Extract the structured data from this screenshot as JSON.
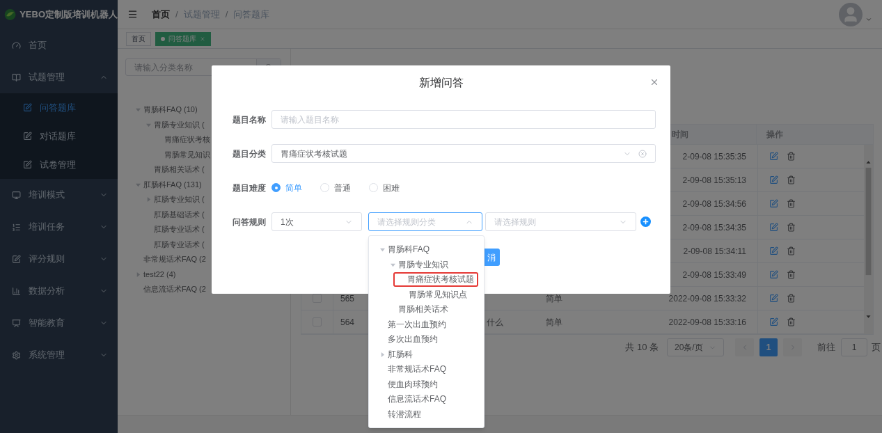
{
  "sidebar": {
    "title": "YEBO定制版培训机器人",
    "items": [
      {
        "label": "首页",
        "kind": "link"
      },
      {
        "label": "试题管理",
        "kind": "group",
        "expanded": true,
        "children": [
          {
            "label": "问答题库",
            "selected": true
          },
          {
            "label": "对话题库",
            "selected": false
          },
          {
            "label": "试卷管理",
            "selected": false
          }
        ]
      },
      {
        "label": "培训模式",
        "kind": "group",
        "expanded": false
      },
      {
        "label": "培训任务",
        "kind": "group",
        "expanded": false
      },
      {
        "label": "评分规则",
        "kind": "group",
        "expanded": false
      },
      {
        "label": "数据分析",
        "kind": "group",
        "expanded": false
      },
      {
        "label": "智能教育",
        "kind": "group",
        "expanded": false
      },
      {
        "label": "系统管理",
        "kind": "group",
        "expanded": false
      }
    ]
  },
  "breadcrumb": [
    {
      "label": "首页",
      "link": true
    },
    {
      "separator": "/",
      "label": "试题管理",
      "link": false
    },
    {
      "separator": "/",
      "label": "问答题库",
      "link": false
    }
  ],
  "tags": [
    {
      "label": "首页",
      "selected": false
    },
    {
      "label": "问答题库",
      "selected": true
    }
  ],
  "category_tree": {
    "search_placeholder": "请输入分类名称",
    "items": [
      {
        "label": "胃肠科FAQ (10)",
        "expanded": true,
        "children": [
          {
            "label": "胃肠专业知识 (",
            "expanded": true,
            "children": [
              {
                "label": "胃痛症状考核"
              },
              {
                "label": "胃肠常见知识"
              }
            ]
          },
          {
            "label": "胃肠相关话术 ("
          }
        ]
      },
      {
        "label": "肛肠科FAQ (131)",
        "expanded": true,
        "children": [
          {
            "label": "肛肠专业知识 (",
            "expanded": false
          },
          {
            "label": "肛肠基础话术 ("
          },
          {
            "label": "肛肠专业话术 ("
          },
          {
            "label": "肛肠专业话术 ("
          }
        ]
      },
      {
        "label": "非常规话术FAQ (2"
      },
      {
        "label": "test22 (4)",
        "expanded": false
      },
      {
        "label": "信息流话术FAQ (2"
      }
    ]
  },
  "table": {
    "columns": [
      {
        "label": "时间",
        "kind": "time"
      },
      {
        "label": "操作",
        "kind": "actions"
      }
    ],
    "rows": [
      {
        "time": "2-09-08 15:35:35"
      },
      {
        "time": "2-09-08 15:35:13"
      },
      {
        "time": "2-09-08 15:34:56"
      },
      {
        "time": "2-09-08 15:34:35"
      },
      {
        "time": "2-09-08 15:34:11"
      },
      {
        "time": "2-09-08 15:33:49"
      },
      {
        "checked": false,
        "id": "565",
        "difficulty": "简单",
        "time": "2022-09-08 15:33:32"
      },
      {
        "checked": false,
        "id": "564",
        "title": "什么",
        "difficulty": "简单",
        "time": "2022-09-08 15:33:16"
      }
    ]
  },
  "pagination": {
    "total": "共 10 条",
    "page_size": "20条/页",
    "pages": [
      {
        "label": "1",
        "selected": true
      }
    ],
    "goto_label": "前往",
    "goto_value": "1",
    "goto_suffix": "页"
  },
  "dialog": {
    "title": "新增问答",
    "fields": [
      {
        "label": "题目名称",
        "kind": "input",
        "placeholder": "请输入题目名称"
      },
      {
        "label": "题目分类",
        "kind": "select",
        "value": "胃痛症状考核试题"
      },
      {
        "label": "题目难度",
        "kind": "radio",
        "options": [
          {
            "label": "简单",
            "selected": true
          },
          {
            "label": "普通",
            "selected": false
          },
          {
            "label": "困难",
            "selected": false
          }
        ]
      },
      {
        "label": "问答规则",
        "kind": "rule",
        "selects": [
          {
            "value": "1次",
            "open": false
          },
          {
            "placeholder": "请选择规则分类",
            "open": true
          },
          {
            "placeholder": "请选择规则",
            "open": false
          }
        ]
      }
    ],
    "button": "消"
  },
  "rule_dropdown": {
    "items": [
      {
        "label": "胃肠科FAQ",
        "expanded": true,
        "highlighted": false,
        "children": [
          {
            "label": "胃肠专业知识",
            "expanded": true,
            "highlighted": false,
            "children": [
              {
                "label": "胃痛症状考核试题",
                "highlighted": true
              },
              {
                "label": "胃肠常见知识点",
                "highlighted": false
              }
            ]
          },
          {
            "label": "胃肠相关话术",
            "highlighted": false
          }
        ]
      },
      {
        "label": "第一次出血预约",
        "highlighted": false
      },
      {
        "label": "多次出血预约",
        "highlighted": false
      },
      {
        "label": "肛肠科",
        "expanded": false,
        "highlighted": false
      },
      {
        "label": "非常规话术FAQ",
        "highlighted": false
      },
      {
        "label": "便血肉球预约",
        "highlighted": false
      },
      {
        "label": "信息流话术FAQ",
        "highlighted": false
      },
      {
        "label": "转潜流程",
        "highlighted": false
      }
    ]
  }
}
